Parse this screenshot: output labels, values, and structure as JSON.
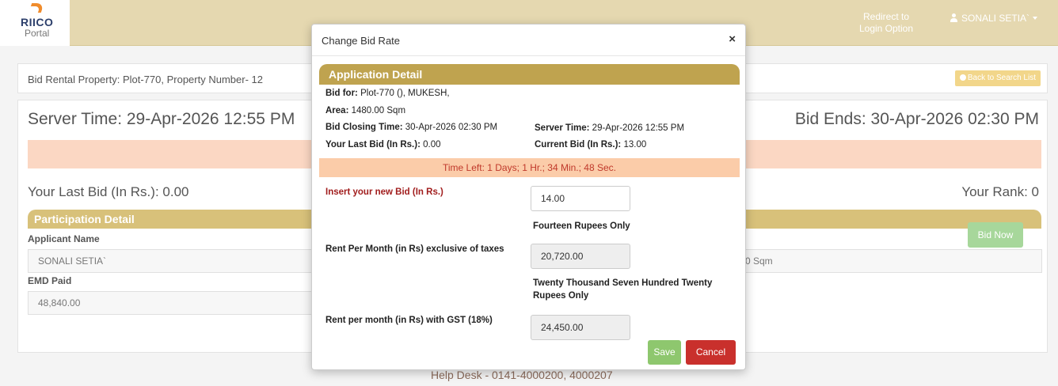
{
  "header": {
    "logo_text": "RIICO",
    "logo_sub": "Portal",
    "redirect_label": "Redirect to Login Option",
    "user_name": "SONALI SETIA`"
  },
  "page": {
    "bar_title": "Bid Rental Property: Plot-770, Property Number- 12",
    "back_label": "Back to Search List",
    "server_time": "Server Time: 29-Apr-2026 12:55 PM",
    "bid_ends": "Bid Ends: 30-Apr-2026 02:30 PM",
    "last_bid": "Your Last Bid (In Rs.): 0.00",
    "your_rank": "Your Rank: 0",
    "participation_header": "Participation Detail",
    "applicant_name_label": "Applicant Name",
    "applicant_name_value": "SONALI SETIA`",
    "area_partial": "0 Sqm",
    "emd_label": "EMD Paid",
    "emd_value": "48,840.00",
    "bid_now": "Bid Now",
    "help_desk": "Help Desk - 0141-4000200, 4000207"
  },
  "modal": {
    "title": "Change Bid Rate",
    "close": "×",
    "app_header": "Application Detail",
    "bid_for_label": "Bid for:",
    "bid_for_value": "Plot-770 (), MUKESH,",
    "area_label": "Area:",
    "area_value": "1480.00 Sqm",
    "closing_label": "Bid Closing Time:",
    "closing_value": "30-Apr-2026 02:30 PM",
    "server_label": "Server Time:",
    "server_value": "29-Apr-2026 12:55 PM",
    "last_bid_label": "Your Last Bid (In Rs.):",
    "last_bid_value": "0.00",
    "current_bid_label": "Current Bid (In Rs.):",
    "current_bid_value": "13.00",
    "time_left": "Time Left: 1 Days; 1 Hr.; 34 Min.; 48 Sec.",
    "new_bid_label": "Insert your new Bid (In Rs.)",
    "new_bid_value": "14.00",
    "new_bid_words": "Fourteen Rupees Only",
    "rent_label": "Rent Per Month (in Rs) exclusive of taxes",
    "rent_value": "20,720.00",
    "rent_words": "Twenty Thousand Seven Hundred Twenty Rupees Only",
    "gst_label": "Rent per month (in Rs) with GST (18%)",
    "gst_value": "24,450.00",
    "save": "Save",
    "cancel": "Cancel"
  },
  "colors": {
    "header_bg": "#e5d8b0",
    "section_header": "#bfa34f",
    "time_left_bg": "#fbcca9",
    "save": "#8ec76e",
    "cancel": "#c9302c"
  }
}
